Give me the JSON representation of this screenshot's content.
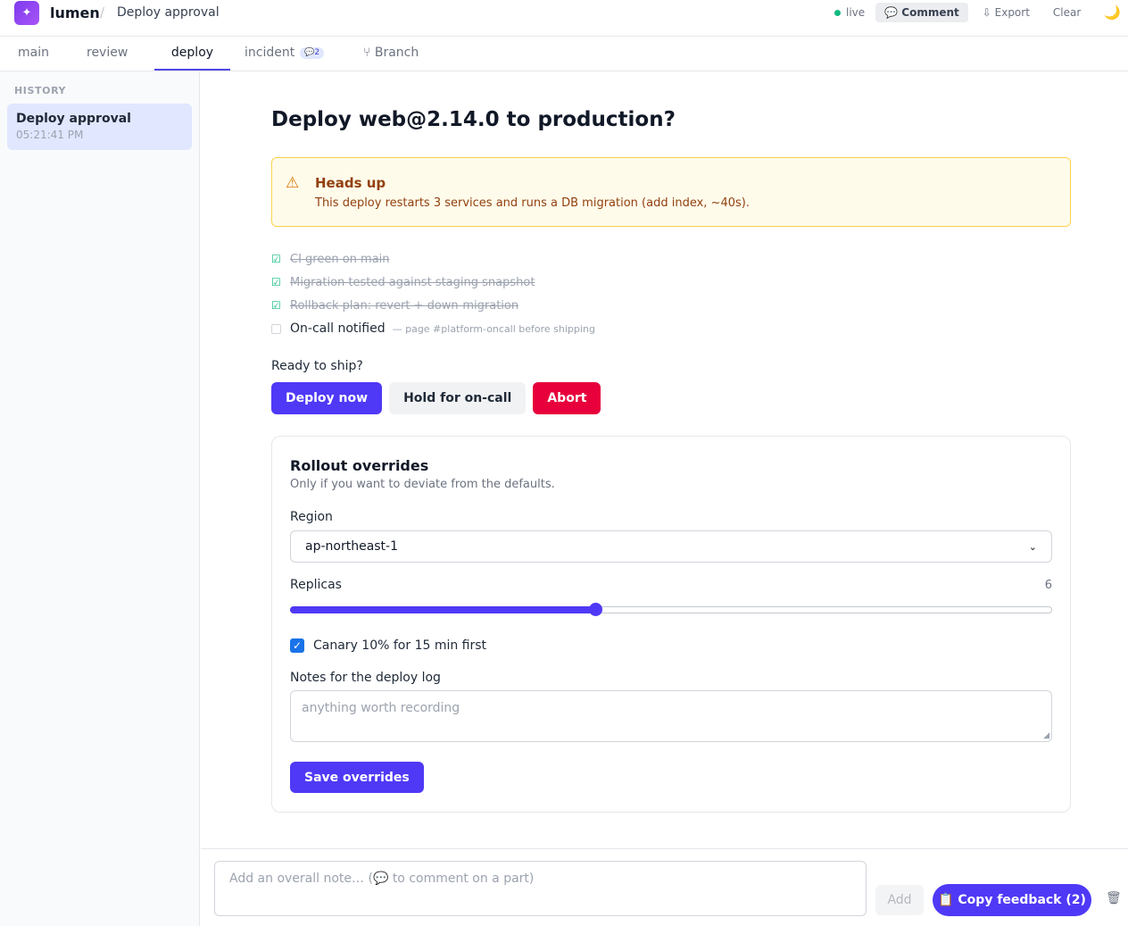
{
  "header": {
    "brand": "lumen",
    "breadcrumb_sep": "/",
    "breadcrumb": "Deploy approval",
    "status": "live",
    "comment_label": "💬 Comment",
    "export_label": "⇩ Export",
    "clear_label": "Clear",
    "theme_icon": "moon-icon"
  },
  "tabs": [
    {
      "label": "main",
      "active": false
    },
    {
      "label": "review",
      "active": false
    },
    {
      "label": "deploy",
      "active": true
    },
    {
      "label": "incident",
      "badge": "💬2",
      "active": false
    },
    {
      "label": "⑂ Branch",
      "active": false
    }
  ],
  "sidebar": {
    "title": "HISTORY",
    "items": [
      {
        "title": "Deploy approval",
        "time": "05:21:41 PM",
        "selected": true
      }
    ]
  },
  "main": {
    "title": "Deploy web@2.14.0 to production?",
    "alert": {
      "icon": "warning-icon",
      "title": "Heads up",
      "text": "This deploy restarts 3 services and runs a DB migration (add index, ~40s)."
    },
    "checklist": [
      {
        "label": "CI green on main",
        "done": true
      },
      {
        "label": "Migration tested against staging snapshot",
        "done": true
      },
      {
        "label": "Rollback plan: revert + down-migration",
        "done": true
      },
      {
        "label": "On-call notified",
        "done": false,
        "hint": "— page #platform-oncall before shipping"
      }
    ],
    "ready_label": "Ready to ship?",
    "actions": {
      "deploy": "Deploy now",
      "hold": "Hold for on-call",
      "abort": "Abort"
    }
  },
  "overrides": {
    "title": "Rollout overrides",
    "subtitle": "Only if you want to deviate from the defaults.",
    "region_label": "Region",
    "region_value": "ap-northeast-1",
    "replicas_label": "Replicas",
    "replicas_value": "6",
    "replicas_fraction": 0.4,
    "canary_label": "Canary 10% for 15 min first",
    "canary_checked": true,
    "notes_label": "Notes for the deploy log",
    "notes_placeholder": "anything worth recording",
    "save_label": "Save overrides"
  },
  "footer": {
    "note_placeholder": "Add an overall note… (💬 to comment on a part)",
    "add_label": "Add",
    "copy_label": "📋 Copy feedback (2)",
    "trash_icon": "🗑"
  },
  "colors": {
    "accent": "#4f39f6",
    "danger": "#e7003c",
    "warning_bg": "#fffbeb",
    "success": "#10b981"
  }
}
